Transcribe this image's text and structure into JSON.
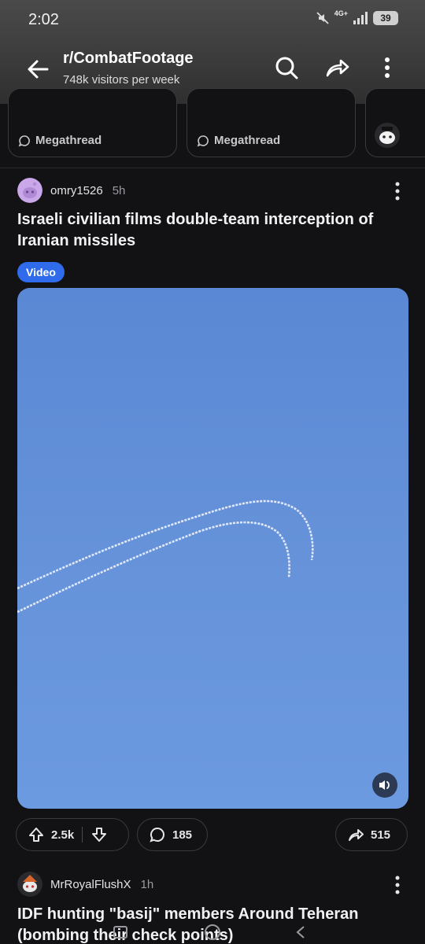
{
  "status": {
    "time": "2:02",
    "network": "4G+",
    "battery": "39"
  },
  "header": {
    "subreddit": "r/CombatFootage",
    "visitors": "748k visitors per week",
    "icons": [
      "back-arrow-icon",
      "search-icon",
      "share-icon",
      "more-vertical-icon"
    ]
  },
  "megathreads": [
    {
      "label": "Megathread"
    },
    {
      "label": "Megathread"
    }
  ],
  "post": {
    "author": "omry1526",
    "age": "5h",
    "title": "Israeli civilian films double-team interception of Iranian missiles",
    "flair": "Video",
    "media_color": "#6592d9",
    "upvotes": "2.5k",
    "comments": "185",
    "shares": "515"
  },
  "next_post": {
    "author": "MrRoyalFlushX",
    "age": "1h",
    "title": "IDF hunting \"basij\" members Around Teheran",
    "title_line2": "(bombing their check points)"
  },
  "colors": {
    "background": "#121214",
    "flair": "#2f6bea",
    "accent_text": "#f1f1f3"
  }
}
